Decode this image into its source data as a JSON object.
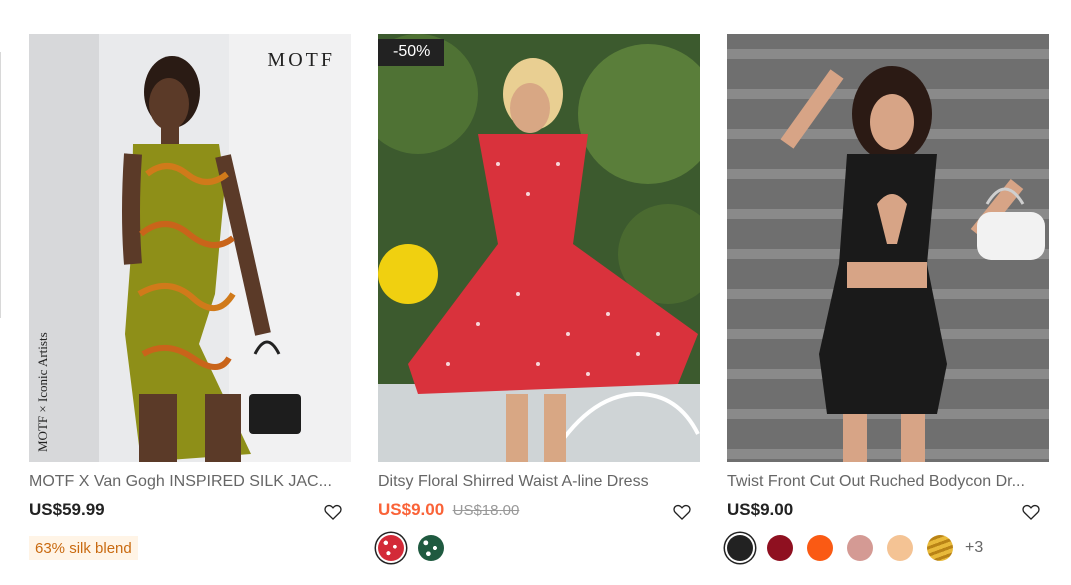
{
  "products": [
    {
      "title": "MOTF X Van Gogh INSPIRED SILK JAC...",
      "price": "US$59.99",
      "brand_mark": "MOTF",
      "vertical_mark": "MOTF × Iconic Artists",
      "tag": "63% silk blend"
    },
    {
      "title": "Ditsy Floral Shirred Waist A-line Dress",
      "price": "US$9.00",
      "original_price": "US$18.00",
      "badge": "-50%",
      "swatches": [
        "red-ditsy-floral",
        "green-ditsy-floral"
      ]
    },
    {
      "title": "Twist Front Cut Out Ruched Bodycon Dr...",
      "price": "US$9.00",
      "swatches": [
        "#222222",
        "#8f1020",
        "#fa5a14",
        "#d49a94",
        "#f4c394",
        "#d4a02a"
      ],
      "more": "+3"
    }
  ],
  "icons": {
    "wishlist": "heart-outline-icon"
  },
  "colors": {
    "sale_price": "#fa6338",
    "tag_bg": "#fff4e6",
    "tag_text": "#c96a10"
  }
}
